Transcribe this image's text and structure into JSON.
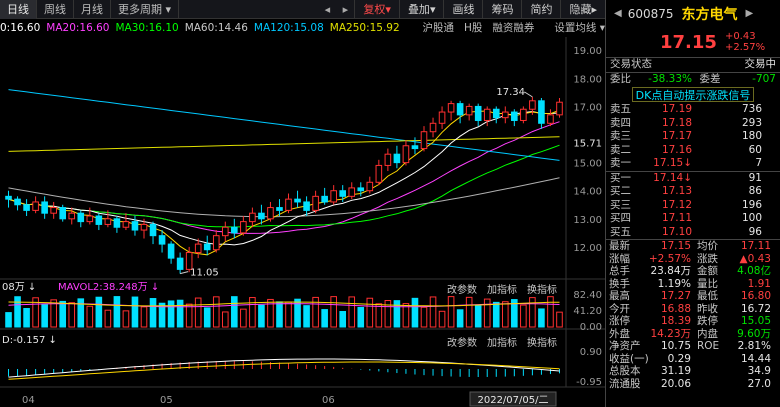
{
  "toolbar": {
    "tabs": [
      "日线",
      "周线",
      "月线",
      "更多周期"
    ],
    "active_tab": 0,
    "buttons": [
      "复权",
      "叠加",
      "画线",
      "筹码",
      "简约",
      "隐藏"
    ],
    "red_button": 0
  },
  "ma_row": {
    "items": [
      {
        "label": "0:16.60",
        "color": "#ffffff"
      },
      {
        "label": "MA20:16.60",
        "color": "#ff40ff"
      },
      {
        "label": "MA30:16.10",
        "color": "#00ff00"
      },
      {
        "label": "MA60:14.46",
        "color": "#c8c8c8"
      },
      {
        "label": "MA120:15.08",
        "color": "#00c8ff"
      },
      {
        "label": "MA250:15.92",
        "color": "#e0e000"
      }
    ],
    "right": [
      "沪股通",
      "H股",
      "融资融券",
      "设置均线"
    ]
  },
  "chart_data": {
    "type": "candlestick",
    "price_axis": [
      "19.00",
      "18.00",
      "17.00",
      "15.71",
      "15.00",
      "14.00",
      "13.00",
      "12.00"
    ],
    "price_range": [
      11.0,
      19.4
    ],
    "max_label": "17.34",
    "min_label": "11.05",
    "current_price_label": "15.71",
    "x_labels": [
      "04",
      "05",
      "06",
      "2022/07/05/二"
    ],
    "candles": [
      [
        13.8,
        13.7,
        14.0,
        13.4
      ],
      [
        13.7,
        13.5,
        13.8,
        13.3
      ],
      [
        13.5,
        13.3,
        13.7,
        13.1
      ],
      [
        13.3,
        13.6,
        13.8,
        13.2
      ],
      [
        13.6,
        13.2,
        13.8,
        13.0
      ],
      [
        13.2,
        13.4,
        13.6,
        13.0
      ],
      [
        13.4,
        13.0,
        13.5,
        12.9
      ],
      [
        13.0,
        13.2,
        13.4,
        12.8
      ],
      [
        13.2,
        12.9,
        13.3,
        12.7
      ],
      [
        12.9,
        13.1,
        13.4,
        12.8
      ],
      [
        13.1,
        12.8,
        13.2,
        12.6
      ],
      [
        12.8,
        13.0,
        13.3,
        12.7
      ],
      [
        13.0,
        12.7,
        13.1,
        12.5
      ],
      [
        12.7,
        12.9,
        13.2,
        12.6
      ],
      [
        12.9,
        12.6,
        13.1,
        12.4
      ],
      [
        12.6,
        12.8,
        13.0,
        12.3
      ],
      [
        12.8,
        12.4,
        12.9,
        12.1
      ],
      [
        12.4,
        12.1,
        12.6,
        11.8
      ],
      [
        12.1,
        11.6,
        12.2,
        11.4
      ],
      [
        11.6,
        11.2,
        11.8,
        11.05
      ],
      [
        11.2,
        11.8,
        12.0,
        11.1
      ],
      [
        11.8,
        12.1,
        12.3,
        11.6
      ],
      [
        12.1,
        11.9,
        12.4,
        11.7
      ],
      [
        11.9,
        12.4,
        12.6,
        11.8
      ],
      [
        12.4,
        12.7,
        12.9,
        12.2
      ],
      [
        12.7,
        12.5,
        13.0,
        12.3
      ],
      [
        12.5,
        12.9,
        13.1,
        12.4
      ],
      [
        12.9,
        13.2,
        13.4,
        12.7
      ],
      [
        13.2,
        13.0,
        13.5,
        12.8
      ],
      [
        13.0,
        13.4,
        13.6,
        12.9
      ],
      [
        13.4,
        13.3,
        13.7,
        13.1
      ],
      [
        13.3,
        13.7,
        13.9,
        13.2
      ],
      [
        13.7,
        13.6,
        14.0,
        13.4
      ],
      [
        13.6,
        13.3,
        13.8,
        13.1
      ],
      [
        13.3,
        13.8,
        14.0,
        13.2
      ],
      [
        13.8,
        13.6,
        14.1,
        13.5
      ],
      [
        13.6,
        14.0,
        14.2,
        13.5
      ],
      [
        14.0,
        13.8,
        14.2,
        13.6
      ],
      [
        13.8,
        14.1,
        14.3,
        13.7
      ],
      [
        14.1,
        14.0,
        14.3,
        13.8
      ],
      [
        14.0,
        14.3,
        14.5,
        13.9
      ],
      [
        14.3,
        14.9,
        15.1,
        14.2
      ],
      [
        14.9,
        15.3,
        15.5,
        14.7
      ],
      [
        15.3,
        15.0,
        15.6,
        14.8
      ],
      [
        15.0,
        15.6,
        15.8,
        14.9
      ],
      [
        15.6,
        15.5,
        15.9,
        15.3
      ],
      [
        15.5,
        16.1,
        16.3,
        15.4
      ],
      [
        16.1,
        16.4,
        16.6,
        15.9
      ],
      [
        16.4,
        16.8,
        17.0,
        16.2
      ],
      [
        16.8,
        17.1,
        17.2,
        16.5
      ],
      [
        17.1,
        16.7,
        17.2,
        16.4
      ],
      [
        16.7,
        17.0,
        17.1,
        16.5
      ],
      [
        17.0,
        16.5,
        17.1,
        16.3
      ],
      [
        16.5,
        16.9,
        17.0,
        16.3
      ],
      [
        16.9,
        16.6,
        17.0,
        16.4
      ],
      [
        16.6,
        16.8,
        17.0,
        16.4
      ],
      [
        16.8,
        16.5,
        16.9,
        16.3
      ],
      [
        16.5,
        16.9,
        17.0,
        16.4
      ],
      [
        16.9,
        17.2,
        17.34,
        16.7
      ],
      [
        17.2,
        16.4,
        17.3,
        16.2
      ],
      [
        16.4,
        16.7,
        16.9,
        16.3
      ],
      [
        16.7,
        17.15,
        17.3,
        16.6
      ]
    ],
    "ma_series": [
      {
        "name": "MA20",
        "color": "#ff40ff",
        "start": 12.9,
        "end": 16.6
      },
      {
        "name": "MA30",
        "color": "#00ff00",
        "start": 13.2,
        "end": 16.1
      },
      {
        "name": "MA60",
        "color": "#b0b0b0",
        "start": 14.1,
        "end": 14.46
      },
      {
        "name": "MA120",
        "color": "#00c8ff",
        "start": 17.6,
        "end": 15.08
      },
      {
        "name": "MA250",
        "color": "#e0e000",
        "start": 15.4,
        "end": 15.92
      }
    ],
    "volume": {
      "label": "08万 ↓",
      "label2": "MAVOL2:38.248万 ↓",
      "axis": [
        "82.40",
        "41.20",
        "0.00"
      ]
    },
    "macd": {
      "label": "D:-0.157 ↓",
      "axis": [
        "0.90",
        "-0.95"
      ]
    }
  },
  "pane_buttons": [
    "改参数",
    "加指标",
    "换指标"
  ],
  "panel": {
    "code": "600875",
    "name": "东方电气",
    "price": "17.15",
    "change": "+0.43",
    "change_pct": "+2.57%",
    "status_label": "交易状态",
    "status_value": "交易中",
    "weibi_label": "委比",
    "weibi_value": "-38.33%",
    "weicha_label": "委差",
    "weicha_value": "-707",
    "signal": "DK点自动提示涨跌信号",
    "asks": [
      {
        "label": "卖五",
        "price": "17.19",
        "vol": "736"
      },
      {
        "label": "卖四",
        "price": "17.18",
        "vol": "293"
      },
      {
        "label": "卖三",
        "price": "17.17",
        "vol": "180"
      },
      {
        "label": "卖二",
        "price": "17.16",
        "vol": "60"
      },
      {
        "label": "卖一",
        "price": "17.15↓",
        "vol": "7"
      }
    ],
    "bids": [
      {
        "label": "买一",
        "price": "17.14↓",
        "vol": "91"
      },
      {
        "label": "买二",
        "price": "17.13",
        "vol": "86"
      },
      {
        "label": "买三",
        "price": "17.12",
        "vol": "196"
      },
      {
        "label": "买四",
        "price": "17.11",
        "vol": "100"
      },
      {
        "label": "买五",
        "price": "17.10",
        "vol": "96"
      }
    ],
    "stats": [
      {
        "a": "最新",
        "b": "17.15",
        "bc": "red",
        "c": "均价",
        "d": "17.11",
        "dc": "red"
      },
      {
        "a": "涨幅",
        "b": "+2.57%",
        "bc": "red",
        "c": "涨跌",
        "d": "▲0.43",
        "dc": "red"
      },
      {
        "a": "总手",
        "b": "23.84万",
        "bc": "white",
        "c": "金额",
        "d": "4.08亿",
        "dc": "green"
      },
      {
        "a": "换手",
        "b": "1.19%",
        "bc": "white",
        "c": "量比",
        "d": "1.91",
        "dc": "red"
      },
      {
        "a": "最高",
        "b": "17.27",
        "bc": "red",
        "c": "最低",
        "d": "16.80",
        "dc": "red"
      },
      {
        "a": "今开",
        "b": "16.88",
        "bc": "red",
        "c": "昨收",
        "d": "16.72",
        "dc": "white"
      },
      {
        "a": "涨停",
        "b": "18.39",
        "bc": "red",
        "c": "跌停",
        "d": "15.05",
        "dc": "green"
      },
      {
        "a": "外盘",
        "b": "14.23万",
        "bc": "red",
        "c": "内盘",
        "d": "9.60万",
        "dc": "green"
      },
      {
        "a": "净资产",
        "b": "10.75",
        "bc": "white",
        "c": "ROE",
        "d": "2.81%",
        "dc": "white"
      },
      {
        "a": "收益(一)",
        "b": "0.29",
        "bc": "white",
        "c": "",
        "d": "14.44",
        "dc": "white"
      },
      {
        "a": "总股本",
        "b": "31.19",
        "bc": "white",
        "c": "",
        "d": "34.9",
        "dc": "white"
      },
      {
        "a": "流通股",
        "b": "20.06",
        "bc": "white",
        "c": "",
        "d": "27.0",
        "dc": "white"
      }
    ]
  }
}
